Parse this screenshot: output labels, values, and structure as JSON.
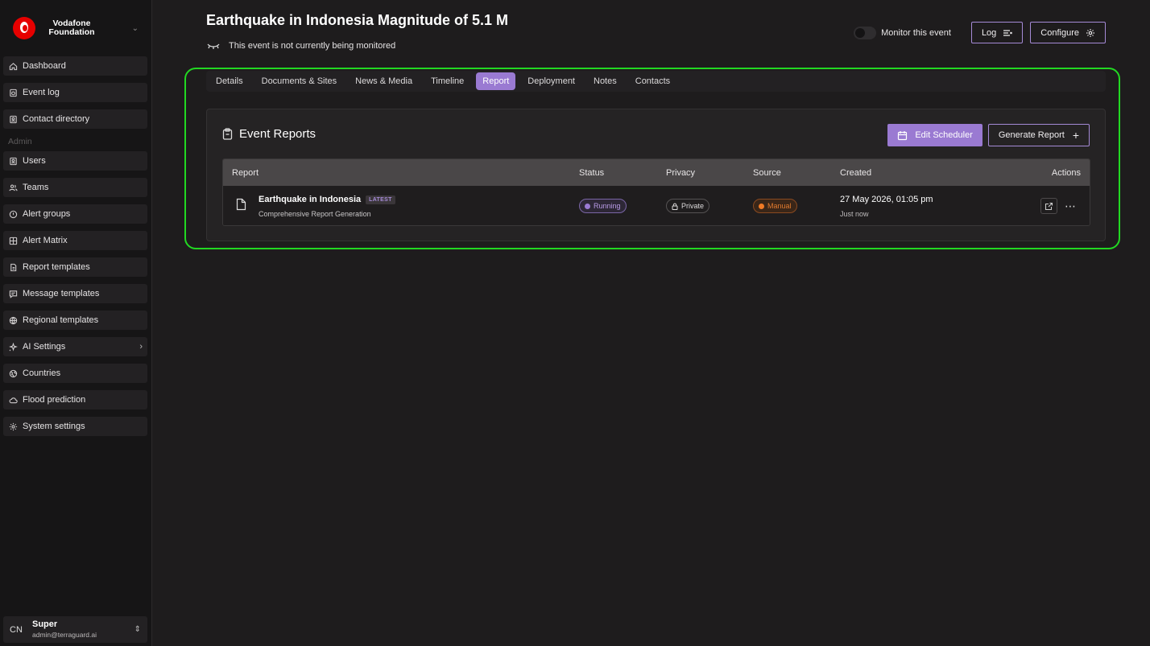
{
  "brand": {
    "name": "Vodafone Foundation"
  },
  "sidebar": {
    "items": [
      {
        "label": "Dashboard",
        "icon": "home-icon"
      },
      {
        "label": "Event log",
        "icon": "event-log-icon"
      },
      {
        "label": "Contact directory",
        "icon": "contact-book-icon"
      }
    ],
    "section_label": "Admin",
    "admin_items": [
      {
        "label": "Users",
        "icon": "user-card-icon"
      },
      {
        "label": "Teams",
        "icon": "team-icon"
      },
      {
        "label": "Alert groups",
        "icon": "alert-icon"
      },
      {
        "label": "Alert Matrix",
        "icon": "grid-icon"
      },
      {
        "label": "Report templates",
        "icon": "report-template-icon"
      },
      {
        "label": "Message templates",
        "icon": "message-icon"
      },
      {
        "label": "Regional templates",
        "icon": "globe-icon"
      },
      {
        "label": "AI Settings",
        "icon": "sparkle-icon",
        "arrow": "›"
      },
      {
        "label": "Countries",
        "icon": "countries-icon"
      },
      {
        "label": "Flood prediction",
        "icon": "cloud-icon"
      },
      {
        "label": "System settings",
        "icon": "gear-icon"
      }
    ],
    "user": {
      "initials": "CN",
      "name": "Super",
      "email": "admin@terraguard.ai"
    }
  },
  "header": {
    "title": "Earthquake in Indonesia Magnitude of 5.1 M",
    "monitor_status": "This event is not currently being monitored",
    "toggle_label": "Monitor this event",
    "log_label": "Log",
    "configure_label": "Configure"
  },
  "tabs": [
    "Details",
    "Documents & Sites",
    "News & Media",
    "Timeline",
    "Report",
    "Deployment",
    "Notes",
    "Contacts"
  ],
  "active_tab": "Report",
  "reports": {
    "heading": "Event Reports",
    "edit_scheduler_label": "Edit Scheduler",
    "generate_label": "Generate Report",
    "columns": {
      "report": "Report",
      "status": "Status",
      "privacy": "Privacy",
      "source": "Source",
      "created": "Created",
      "actions": "Actions"
    },
    "rows": [
      {
        "title": "Earthquake in Indonesia",
        "badge": "LATEST",
        "subtitle": "Comprehensive Report Generation",
        "status": "Running",
        "privacy": "Private",
        "source": "Manual",
        "created": "27 May 2026, 01:05 pm",
        "created_relative": "Just now"
      }
    ]
  },
  "colors": {
    "accent": "#9a7ad2",
    "highlight": "#22d822",
    "manual": "#f07a25"
  }
}
